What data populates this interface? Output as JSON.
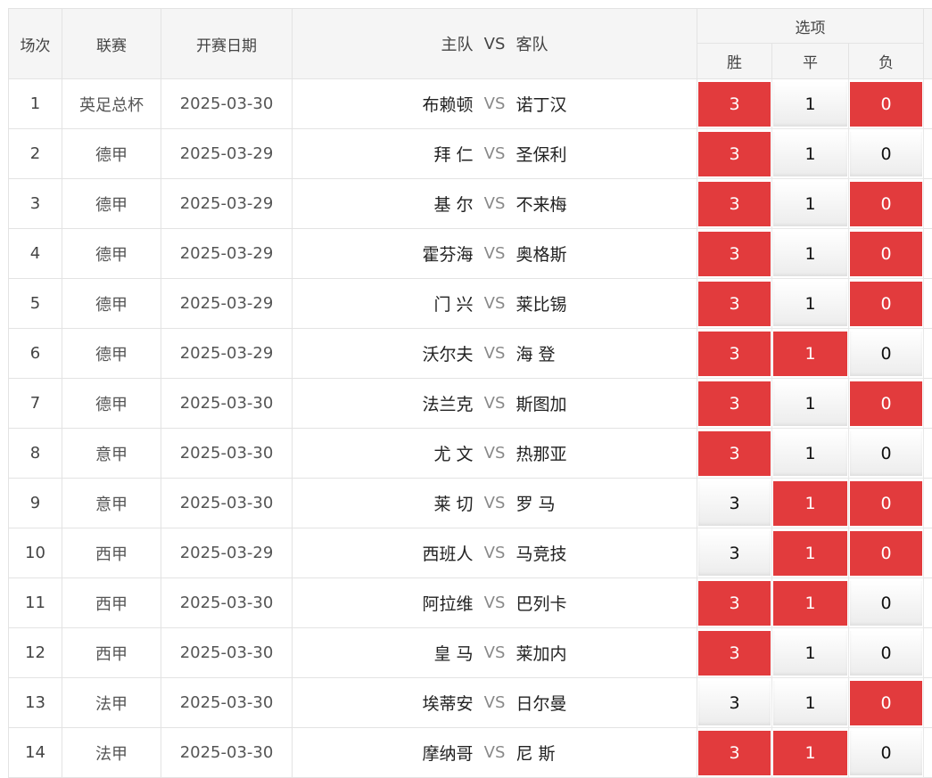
{
  "header": {
    "col_index": "场次",
    "col_league": "联赛",
    "col_date": "开赛日期",
    "col_home": "主队",
    "col_vs": "VS",
    "col_away": "客队",
    "col_options": "选项",
    "opt_win": "胜",
    "opt_draw": "平",
    "opt_lose": "负"
  },
  "colors": {
    "selected": "#e23b3d",
    "unselected": "#f2f2f2"
  },
  "matches": [
    {
      "idx": "1",
      "league": "英足总杯",
      "date": "2025-03-30",
      "home": "布赖顿",
      "vs": "VS",
      "away": "诺丁汉",
      "w": "3",
      "d": "1",
      "l": "0",
      "sel": [
        true,
        false,
        true
      ]
    },
    {
      "idx": "2",
      "league": "德甲",
      "date": "2025-03-29",
      "home": "拜 仁",
      "vs": "VS",
      "away": "圣保利",
      "w": "3",
      "d": "1",
      "l": "0",
      "sel": [
        true,
        false,
        false
      ]
    },
    {
      "idx": "3",
      "league": "德甲",
      "date": "2025-03-29",
      "home": "基 尔",
      "vs": "VS",
      "away": "不来梅",
      "w": "3",
      "d": "1",
      "l": "0",
      "sel": [
        true,
        false,
        true
      ]
    },
    {
      "idx": "4",
      "league": "德甲",
      "date": "2025-03-29",
      "home": "霍芬海",
      "vs": "VS",
      "away": "奥格斯",
      "w": "3",
      "d": "1",
      "l": "0",
      "sel": [
        true,
        false,
        true
      ]
    },
    {
      "idx": "5",
      "league": "德甲",
      "date": "2025-03-29",
      "home": "门 兴",
      "vs": "VS",
      "away": "莱比锡",
      "w": "3",
      "d": "1",
      "l": "0",
      "sel": [
        true,
        false,
        true
      ]
    },
    {
      "idx": "6",
      "league": "德甲",
      "date": "2025-03-29",
      "home": "沃尔夫",
      "vs": "VS",
      "away": "海 登",
      "w": "3",
      "d": "1",
      "l": "0",
      "sel": [
        true,
        true,
        false
      ]
    },
    {
      "idx": "7",
      "league": "德甲",
      "date": "2025-03-30",
      "home": "法兰克",
      "vs": "VS",
      "away": "斯图加",
      "w": "3",
      "d": "1",
      "l": "0",
      "sel": [
        true,
        false,
        true
      ]
    },
    {
      "idx": "8",
      "league": "意甲",
      "date": "2025-03-30",
      "home": "尤 文",
      "vs": "VS",
      "away": "热那亚",
      "w": "3",
      "d": "1",
      "l": "0",
      "sel": [
        true,
        false,
        false
      ]
    },
    {
      "idx": "9",
      "league": "意甲",
      "date": "2025-03-30",
      "home": "莱 切",
      "vs": "VS",
      "away": "罗 马",
      "w": "3",
      "d": "1",
      "l": "0",
      "sel": [
        false,
        true,
        true
      ]
    },
    {
      "idx": "10",
      "league": "西甲",
      "date": "2025-03-29",
      "home": "西班人",
      "vs": "VS",
      "away": "马竞技",
      "w": "3",
      "d": "1",
      "l": "0",
      "sel": [
        false,
        true,
        true
      ]
    },
    {
      "idx": "11",
      "league": "西甲",
      "date": "2025-03-30",
      "home": "阿拉维",
      "vs": "VS",
      "away": "巴列卡",
      "w": "3",
      "d": "1",
      "l": "0",
      "sel": [
        true,
        true,
        false
      ]
    },
    {
      "idx": "12",
      "league": "西甲",
      "date": "2025-03-30",
      "home": "皇 马",
      "vs": "VS",
      "away": "莱加内",
      "w": "3",
      "d": "1",
      "l": "0",
      "sel": [
        true,
        false,
        false
      ]
    },
    {
      "idx": "13",
      "league": "法甲",
      "date": "2025-03-30",
      "home": "埃蒂安",
      "vs": "VS",
      "away": "日尔曼",
      "w": "3",
      "d": "1",
      "l": "0",
      "sel": [
        false,
        false,
        true
      ]
    },
    {
      "idx": "14",
      "league": "法甲",
      "date": "2025-03-30",
      "home": "摩纳哥",
      "vs": "VS",
      "away": "尼 斯",
      "w": "3",
      "d": "1",
      "l": "0",
      "sel": [
        true,
        true,
        false
      ]
    }
  ]
}
